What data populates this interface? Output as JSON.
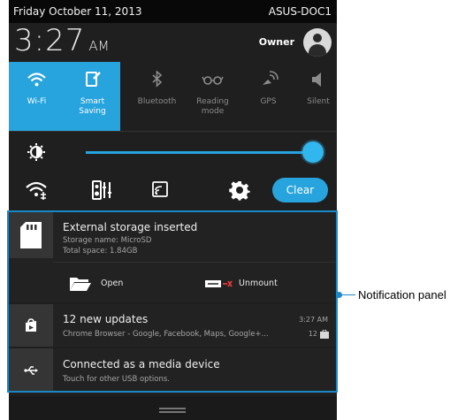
{
  "status_bar": {
    "date": "Friday October 11, 2013",
    "device": "ASUS-DOC1"
  },
  "clock": {
    "time": "3:27",
    "ampm": "AM"
  },
  "user": {
    "name": "Owner",
    "icon": "user-avatar-icon"
  },
  "toggles": [
    {
      "label_line1": "Wi-Fi",
      "label_line2": "",
      "icon": "wifi-icon",
      "active": true
    },
    {
      "label_line1": "Smart",
      "label_line2": "Saving",
      "icon": "smart-saving-icon",
      "active": true
    },
    {
      "label_line1": "Bluetooth",
      "label_line2": "",
      "icon": "bluetooth-icon",
      "active": false
    },
    {
      "label_line1": "Reading",
      "label_line2": "mode",
      "icon": "reading-mode-icon",
      "active": false
    },
    {
      "label_line1": "GPS",
      "label_line2": "",
      "icon": "gps-icon",
      "active": false
    },
    {
      "label_line1": "Silent",
      "label_line2": "",
      "icon": "silent-icon",
      "active": false
    }
  ],
  "brightness": {
    "icon": "brightness-icon",
    "level": 0.96
  },
  "quick_actions": {
    "icons": [
      "wifi-settings-icon",
      "audio-wizard-icon",
      "screen-cast-icon",
      "settings-gear-icon"
    ],
    "clear_label": "Clear"
  },
  "notifications": [
    {
      "title": "External storage inserted",
      "line1": "Storage name: MicroSD",
      "line2": "Total space: 1.84GB",
      "icon": "sd-card-icon",
      "actions": [
        {
          "label": "Open",
          "icon": "folder-icon"
        },
        {
          "label": "Unmount",
          "icon": "unmount-icon"
        }
      ]
    },
    {
      "title": "12 new updates",
      "line1": "Chrome Browser - Google, Facebook, Maps, Google+...",
      "time": "3:27 AM",
      "count": "12",
      "icon": "play-store-icon"
    },
    {
      "title": "Connected as a media device",
      "line1": "Touch for other USB options.",
      "icon": "usb-icon"
    }
  ],
  "callout": {
    "label": "Notification panel"
  },
  "colors": {
    "accent": "#27a4dd",
    "panel": "#1f1f1f",
    "callout": "#1b88c6"
  }
}
